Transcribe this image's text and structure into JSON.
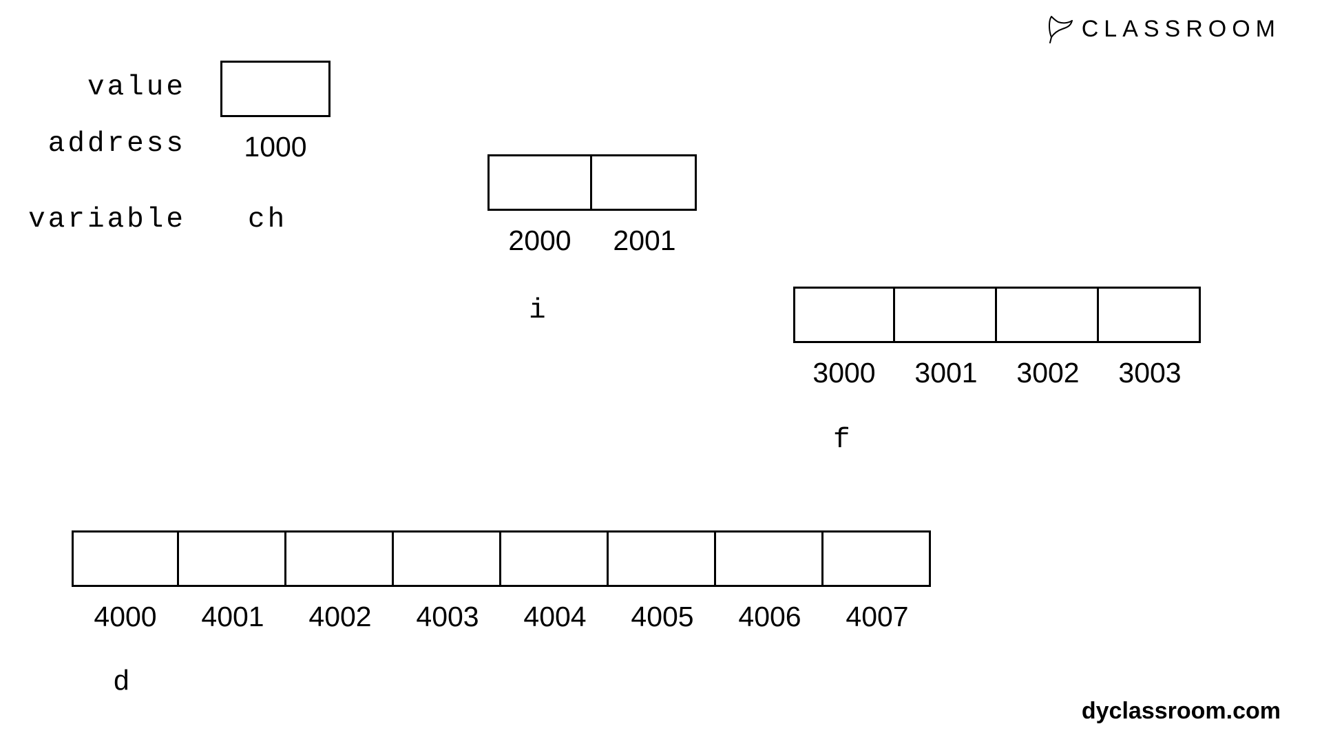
{
  "labels": {
    "value": "value",
    "address": "address",
    "variable": "variable"
  },
  "logo_text": "CLASSROOM",
  "footer": "dyclassroom.com",
  "vars": {
    "ch": {
      "name": "ch",
      "addresses": [
        "1000"
      ]
    },
    "i": {
      "name": "i",
      "addresses": [
        "2000",
        "2001"
      ]
    },
    "f": {
      "name": "f",
      "addresses": [
        "3000",
        "3001",
        "3002",
        "3003"
      ]
    },
    "d": {
      "name": "d",
      "addresses": [
        "4000",
        "4001",
        "4002",
        "4003",
        "4004",
        "4005",
        "4006",
        "4007"
      ]
    }
  }
}
